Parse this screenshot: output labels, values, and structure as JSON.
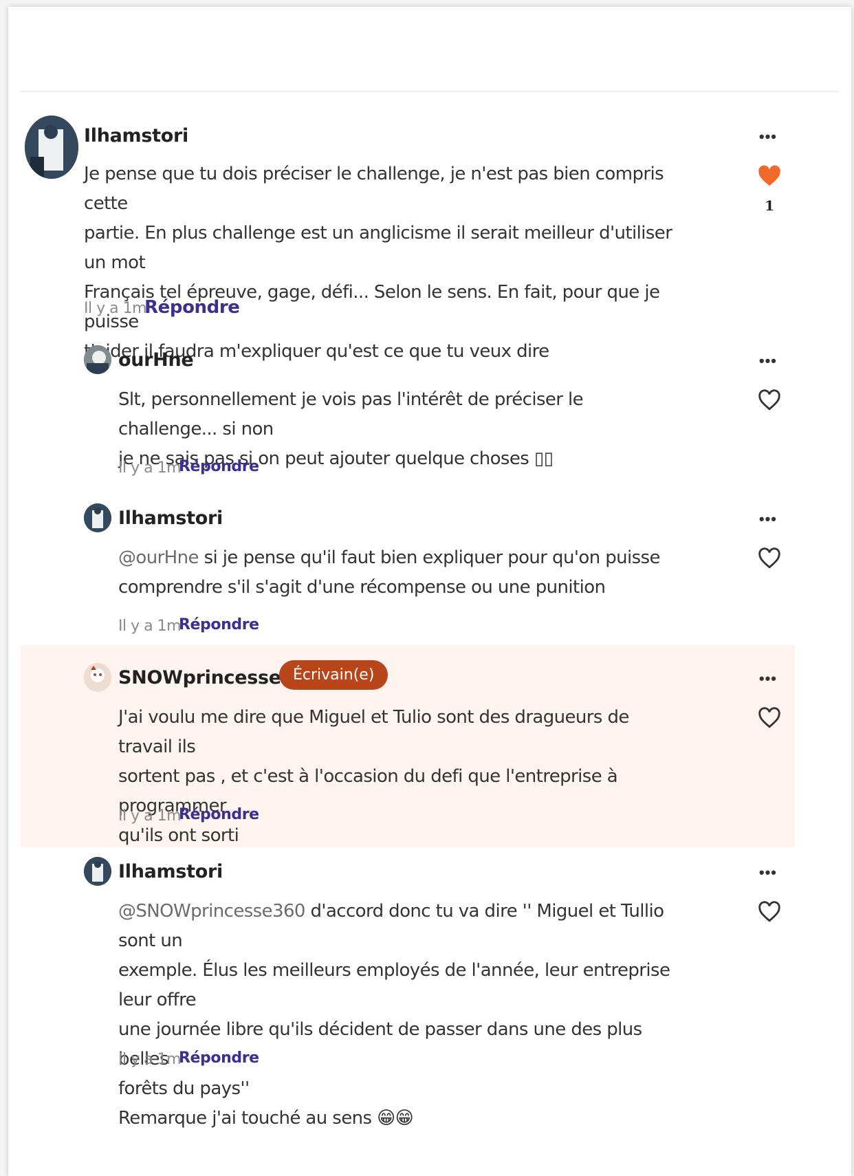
{
  "comments": [
    {
      "username": "Ilhamstori",
      "text": "Je pense que tu dois préciser le challenge, je n'est pas bien compris cette\npartie. En plus challenge est un anglicisme il serait meilleur d'utiliser un mot\nFrançais tel épreuve, gage, défi... Selon le sens. En fait, pour que je puisse\nt'aider il faudra m'expliquer qu'est ce que tu veux dire",
      "time": "Il y a 1m",
      "reply": "Répondre",
      "likes": "1",
      "liked": true
    },
    {
      "username": "ourHne",
      "text": "Slt,  personnellement je vois pas l'intérêt de préciser le challenge... si non\nje ne sais pas si on peut ajouter quelque choses ▯▯",
      "time": "Il y a 1m",
      "reply": "Répondre"
    },
    {
      "username": "Ilhamstori",
      "mention": "@ourHne",
      "text": " si je pense qu'il faut bien expliquer pour qu'on puisse\ncomprendre s'il s'agit d'une récompense ou une punition",
      "time": "Il y a 1m",
      "reply": "Répondre"
    },
    {
      "username": "SNOWprincesse360",
      "badge": "Écrivain(e)",
      "text": "J'ai voulu me dire que Miguel et Tulio sont des dragueurs de travail ils\nsortent pas , et c'est à l'occasion du defi que l'entreprise à programmer\nqu'ils ont sorti",
      "time": "Il y a 1m",
      "reply": "Répondre"
    },
    {
      "username": "Ilhamstori",
      "mention": "@SNOWprincesse360",
      "text": " d'accord donc tu va dire '' Miguel et Tullio sont un\nexemple. Élus les meilleurs employés de l'année, leur entreprise leur offre\nune journée libre qu'ils décident de  passer dans une des plus belles\nforêts du pays''\nRemarque j'ai touché au sens 😁😁",
      "time": "Il y a 1m",
      "reply": "Répondre"
    }
  ],
  "colors": {
    "heart_filled": "#f26a2a",
    "reply_link": "#3b2f8f",
    "badge": "#b8461a",
    "highlight_bg": "#fdf3ef"
  },
  "icons": {
    "more": "more-options-icon",
    "like": "heart-icon"
  },
  "more_glyph": "•••"
}
